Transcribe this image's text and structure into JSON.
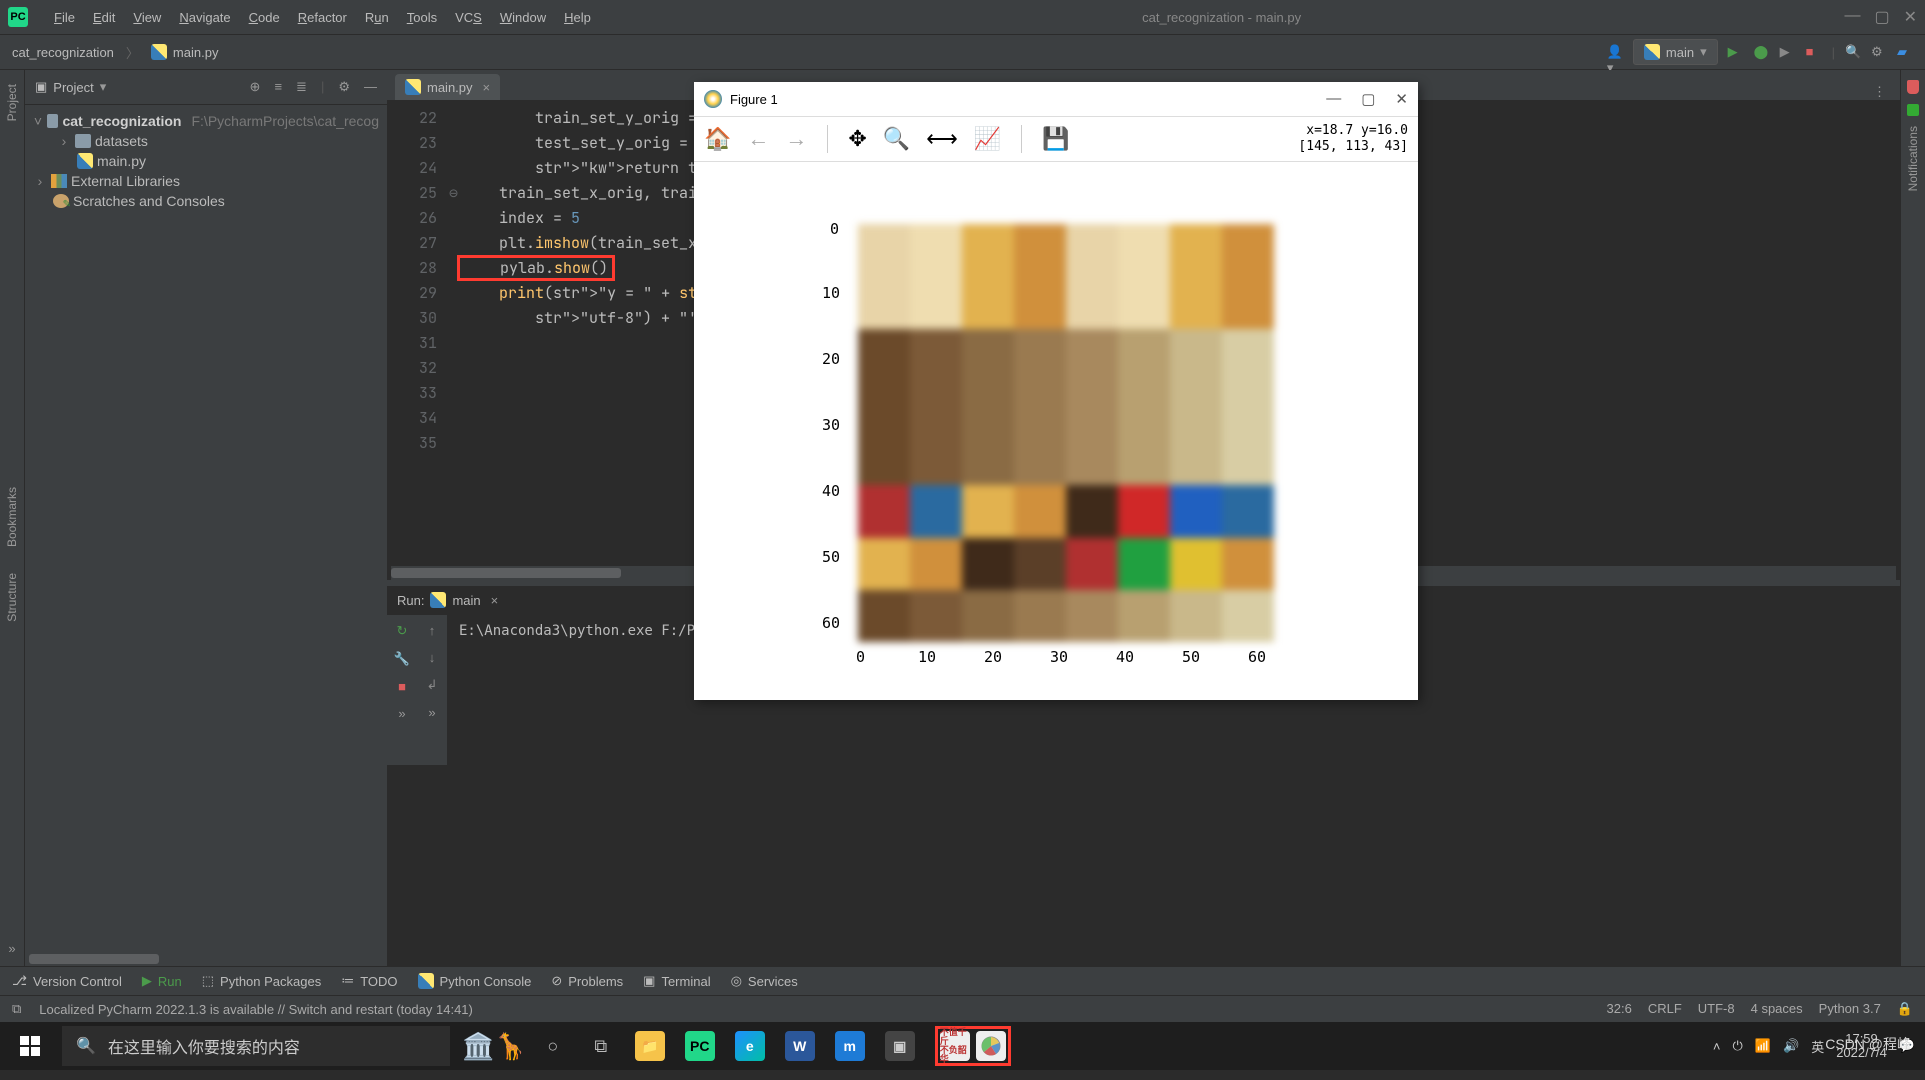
{
  "title": "cat_recognization - main.py",
  "menu": [
    "File",
    "Edit",
    "View",
    "Navigate",
    "Code",
    "Refactor",
    "Run",
    "Tools",
    "VCS",
    "Window",
    "Help"
  ],
  "breadcrumb": {
    "project": "cat_recognization",
    "file": "main.py"
  },
  "run_config": "main",
  "project_panel": {
    "label": "Project",
    "root": {
      "name": "cat_recognization",
      "path": "F:\\PycharmProjects\\cat_recog"
    },
    "children": [
      {
        "name": "datasets",
        "type": "folder",
        "expand": ">"
      },
      {
        "name": "main.py",
        "type": "py"
      },
      {
        "name": "External Libraries",
        "type": "lib",
        "expand": ">"
      },
      {
        "name": "Scratches and Consoles",
        "type": "scratch"
      }
    ]
  },
  "editor": {
    "tab": "main.py",
    "first_line": 22,
    "lines": [
      "        train_set_y_orig = tra",
      "        test_set_y_orig = test",
      "",
      "        return train_set_x_ori",
      "",
      "",
      "    train_set_x_orig, train_se",
      "",
      "    index = 5",
      "    plt.imshow(train_set_x_ori",
      "    pylab.show()",
      "    print(\"y = \" + str(train_s",
      "        \"utf-8\") + \"' picture.",
      ""
    ],
    "highlight_line_index": 10
  },
  "run_panel": {
    "title": "Run:",
    "config": "main",
    "output": "E:\\Anaconda3\\python.exe F:/PycharmProjects/cat_recognization/main"
  },
  "tool_windows": [
    "Version Control",
    "Run",
    "Python Packages",
    "TODO",
    "Python Console",
    "Problems",
    "Terminal",
    "Services"
  ],
  "statusbar": {
    "msg": "Localized PyCharm 2022.1.3 is available // Switch and restart (today 14:41)",
    "pos": "32:6",
    "lineend": "CRLF",
    "enc": "UTF-8",
    "indent": "4 spaces",
    "python": "Python 3.7"
  },
  "sidebars": {
    "left": [
      "Project",
      "Bookmarks",
      "Structure"
    ],
    "right": [
      "Notifications"
    ]
  },
  "figure": {
    "title": "Figure 1",
    "coords": "x=18.7 y=16.0",
    "pixel": "[145, 113, 43]",
    "yticks": [
      "0",
      "10",
      "20",
      "30",
      "40",
      "50",
      "60"
    ],
    "xticks": [
      "0",
      "10",
      "20",
      "30",
      "40",
      "50",
      "60"
    ]
  },
  "taskbar": {
    "search_placeholder": "在这里输入你要搜索的内容",
    "ime": "英",
    "time": "17:59",
    "date": "2022/7/4"
  },
  "watermark": "CSDN @程峰",
  "chart_data": {
    "type": "heatmap",
    "title": "",
    "xlabel": "",
    "ylabel": "",
    "xlim": [
      0,
      63
    ],
    "ylim": [
      0,
      63
    ],
    "note": "64x64 RGB image (train_set_x_orig[5]); cursor sample at (18.7,16.0) = RGB[145,113,43]"
  }
}
